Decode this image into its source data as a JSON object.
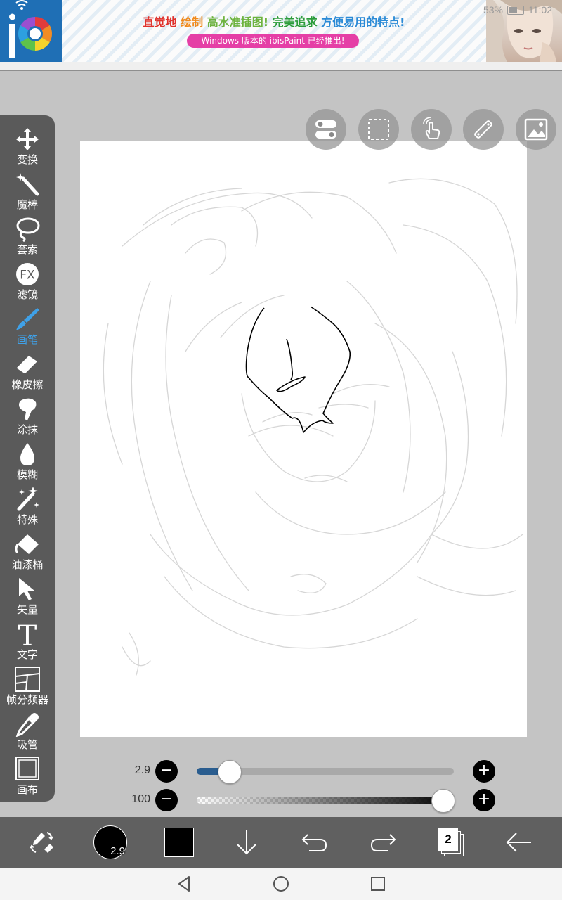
{
  "status_bar": {
    "battery": "53%",
    "time": "11:02"
  },
  "ad": {
    "logo": "iP",
    "headline": [
      {
        "text": "直觉地 ",
        "color": "#e0312b"
      },
      {
        "text": "绘制 ",
        "color": "#f08a1c"
      },
      {
        "text": "高水准插图! ",
        "color": "#6db33f"
      },
      {
        "text": "完美追求 ",
        "color": "#2b9c3a"
      },
      {
        "text": "方便易用的特点!",
        "color": "#2a8ad6"
      }
    ],
    "pill": "Windows 版本的 ibisPaint 已经推出!"
  },
  "top_buttons": [
    {
      "name": "toggle-icon"
    },
    {
      "name": "selection-icon"
    },
    {
      "name": "touch-icon"
    },
    {
      "name": "ruler-icon"
    },
    {
      "name": "image-icon"
    }
  ],
  "tools": [
    {
      "id": "transform",
      "label": "变换",
      "icon": "move-icon"
    },
    {
      "id": "magic-wand",
      "label": "魔棒",
      "icon": "magic-wand-icon"
    },
    {
      "id": "lasso",
      "label": "套索",
      "icon": "lasso-icon"
    },
    {
      "id": "filter",
      "label": "滤镜",
      "icon": "fx-icon",
      "text": "FX"
    },
    {
      "id": "brush",
      "label": "画笔",
      "icon": "brush-icon",
      "active": true
    },
    {
      "id": "eraser",
      "label": "橡皮擦",
      "icon": "eraser-icon"
    },
    {
      "id": "smudge",
      "label": "涂抹",
      "icon": "smudge-icon"
    },
    {
      "id": "blur",
      "label": "模糊",
      "icon": "drop-icon"
    },
    {
      "id": "special",
      "label": "特殊",
      "icon": "sparkle-icon"
    },
    {
      "id": "fill",
      "label": "油漆桶",
      "icon": "bucket-icon"
    },
    {
      "id": "vector",
      "label": "矢量",
      "icon": "arrow-icon"
    },
    {
      "id": "text",
      "label": "文字",
      "icon": "text-icon",
      "text": "T"
    },
    {
      "id": "frame-divider",
      "label": "帧分频器",
      "icon": "frame-icon"
    },
    {
      "id": "eyedropper",
      "label": "吸管",
      "icon": "eyedropper-icon"
    },
    {
      "id": "canvas",
      "label": "画布",
      "icon": "canvas-icon"
    }
  ],
  "sliders": {
    "size": {
      "value": "2.9",
      "fraction": 0.09
    },
    "opacity": {
      "value": "100",
      "fraction": 1.0
    }
  },
  "bottom_bar": {
    "brush_size": "2.9",
    "color": "#000000",
    "layer_count": "2"
  }
}
